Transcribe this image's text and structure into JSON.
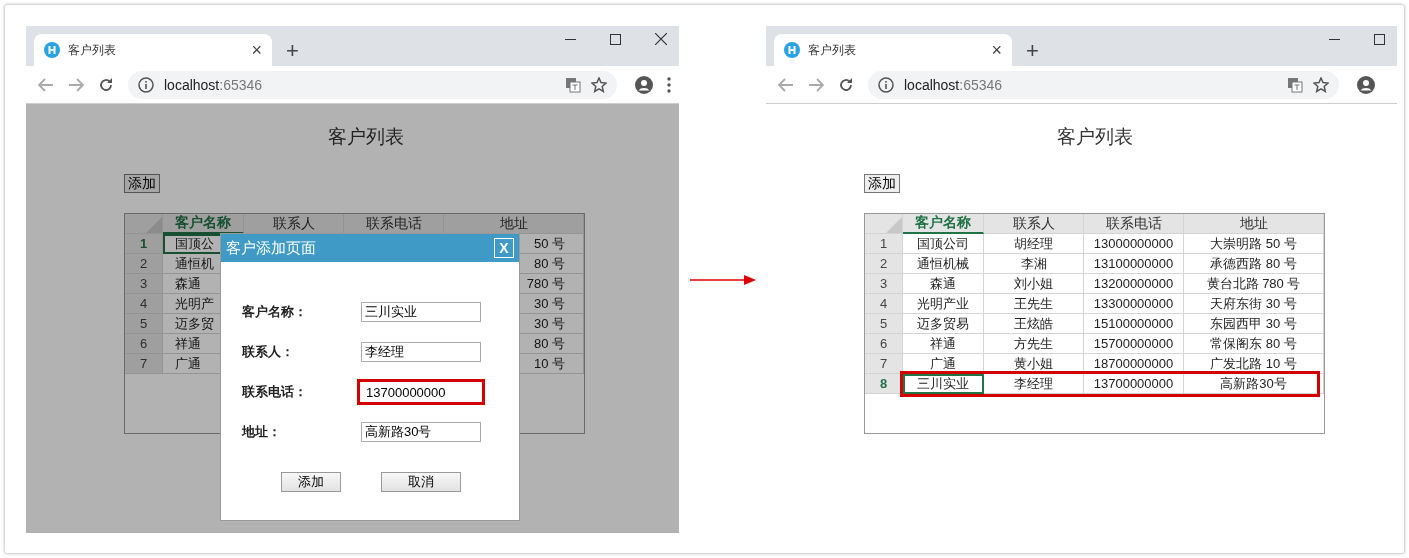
{
  "screenshots": [
    {
      "tab_title": "客户列表",
      "tab_close": "×",
      "new_tab": "+",
      "url_host": "localhost",
      "url_port": ":65346",
      "window_close": true,
      "menu_button": true,
      "overlay": true,
      "page_title": "客户列表",
      "add_button": "添加",
      "table": {
        "columns": [
          {
            "label": "客户名称",
            "selected": true
          },
          {
            "label": "联系人",
            "selected": false
          },
          {
            "label": "联系电话",
            "selected": false
          },
          {
            "label": "地址",
            "selected": false
          }
        ],
        "rows": [
          {
            "number": "1",
            "selected": true,
            "highlighted": false,
            "name": "国顶公",
            "address": "50 号"
          },
          {
            "number": "2",
            "selected": false,
            "highlighted": false,
            "name": "通恒机",
            "address": "80 号"
          },
          {
            "number": "3",
            "selected": false,
            "highlighted": false,
            "name": "森通",
            "address": "780 号"
          },
          {
            "number": "4",
            "selected": false,
            "highlighted": false,
            "name": "光明产",
            "address": "30 号"
          },
          {
            "number": "5",
            "selected": false,
            "highlighted": false,
            "name": "迈多贸",
            "address": "30 号"
          },
          {
            "number": "6",
            "selected": false,
            "highlighted": false,
            "name": "祥通",
            "address": "80 号"
          },
          {
            "number": "7",
            "selected": false,
            "highlighted": false,
            "name": "广通",
            "address": "10 号"
          }
        ]
      },
      "dialog": {
        "title": "客户添加页面",
        "close": "X",
        "fields": [
          {
            "label": "客户名称：",
            "value": "三川实业",
            "highlighted": false
          },
          {
            "label": "联系人：",
            "value": "李经理",
            "highlighted": false
          },
          {
            "label": "联系电话：",
            "value": "13700000000",
            "highlighted": true
          },
          {
            "label": "地址：",
            "value": "高新路30号",
            "highlighted": false
          }
        ],
        "buttons": [
          "添加",
          "取消"
        ]
      }
    },
    {
      "tab_title": "客户列表",
      "tab_close": "×",
      "new_tab": "+",
      "url_host": "localhost",
      "url_port": ":65346",
      "window_close": false,
      "menu_button": false,
      "overlay": false,
      "page_title": "客户列表",
      "add_button": "添加",
      "table": {
        "columns": [
          {
            "label": "客户名称",
            "selected": true
          },
          {
            "label": "联系人",
            "selected": false
          },
          {
            "label": "联系电话",
            "selected": false
          },
          {
            "label": "地址",
            "selected": false
          }
        ],
        "rows": [
          {
            "number": "1",
            "selected": false,
            "highlighted": false,
            "name": "国顶公司",
            "contact": "胡经理",
            "phone": "13000000000",
            "address": "大崇明路 50 号"
          },
          {
            "number": "2",
            "selected": false,
            "highlighted": false,
            "name": "通恒机械",
            "contact": "李湘",
            "phone": "13100000000",
            "address": "承德西路 80 号"
          },
          {
            "number": "3",
            "selected": false,
            "highlighted": false,
            "name": "森通",
            "contact": "刘小姐",
            "phone": "13200000000",
            "address": "黄台北路 780 号"
          },
          {
            "number": "4",
            "selected": false,
            "highlighted": false,
            "name": "光明产业",
            "contact": "王先生",
            "phone": "13300000000",
            "address": "天府东街 30 号"
          },
          {
            "number": "5",
            "selected": false,
            "highlighted": false,
            "name": "迈多贸易",
            "contact": "王炫皓",
            "phone": "15100000000",
            "address": "东园西甲 30 号"
          },
          {
            "number": "6",
            "selected": false,
            "highlighted": false,
            "name": "祥通",
            "contact": "方先生",
            "phone": "15700000000",
            "address": "常保阁东 80 号"
          },
          {
            "number": "7",
            "selected": false,
            "highlighted": false,
            "name": "广通",
            "contact": "黄小姐",
            "phone": "18700000000",
            "address": "广发北路 10 号"
          },
          {
            "number": "8",
            "selected": true,
            "highlighted": true,
            "name": "三川实业",
            "contact": "李经理",
            "phone": "13700000000",
            "address": "高新路30号"
          }
        ]
      }
    }
  ]
}
